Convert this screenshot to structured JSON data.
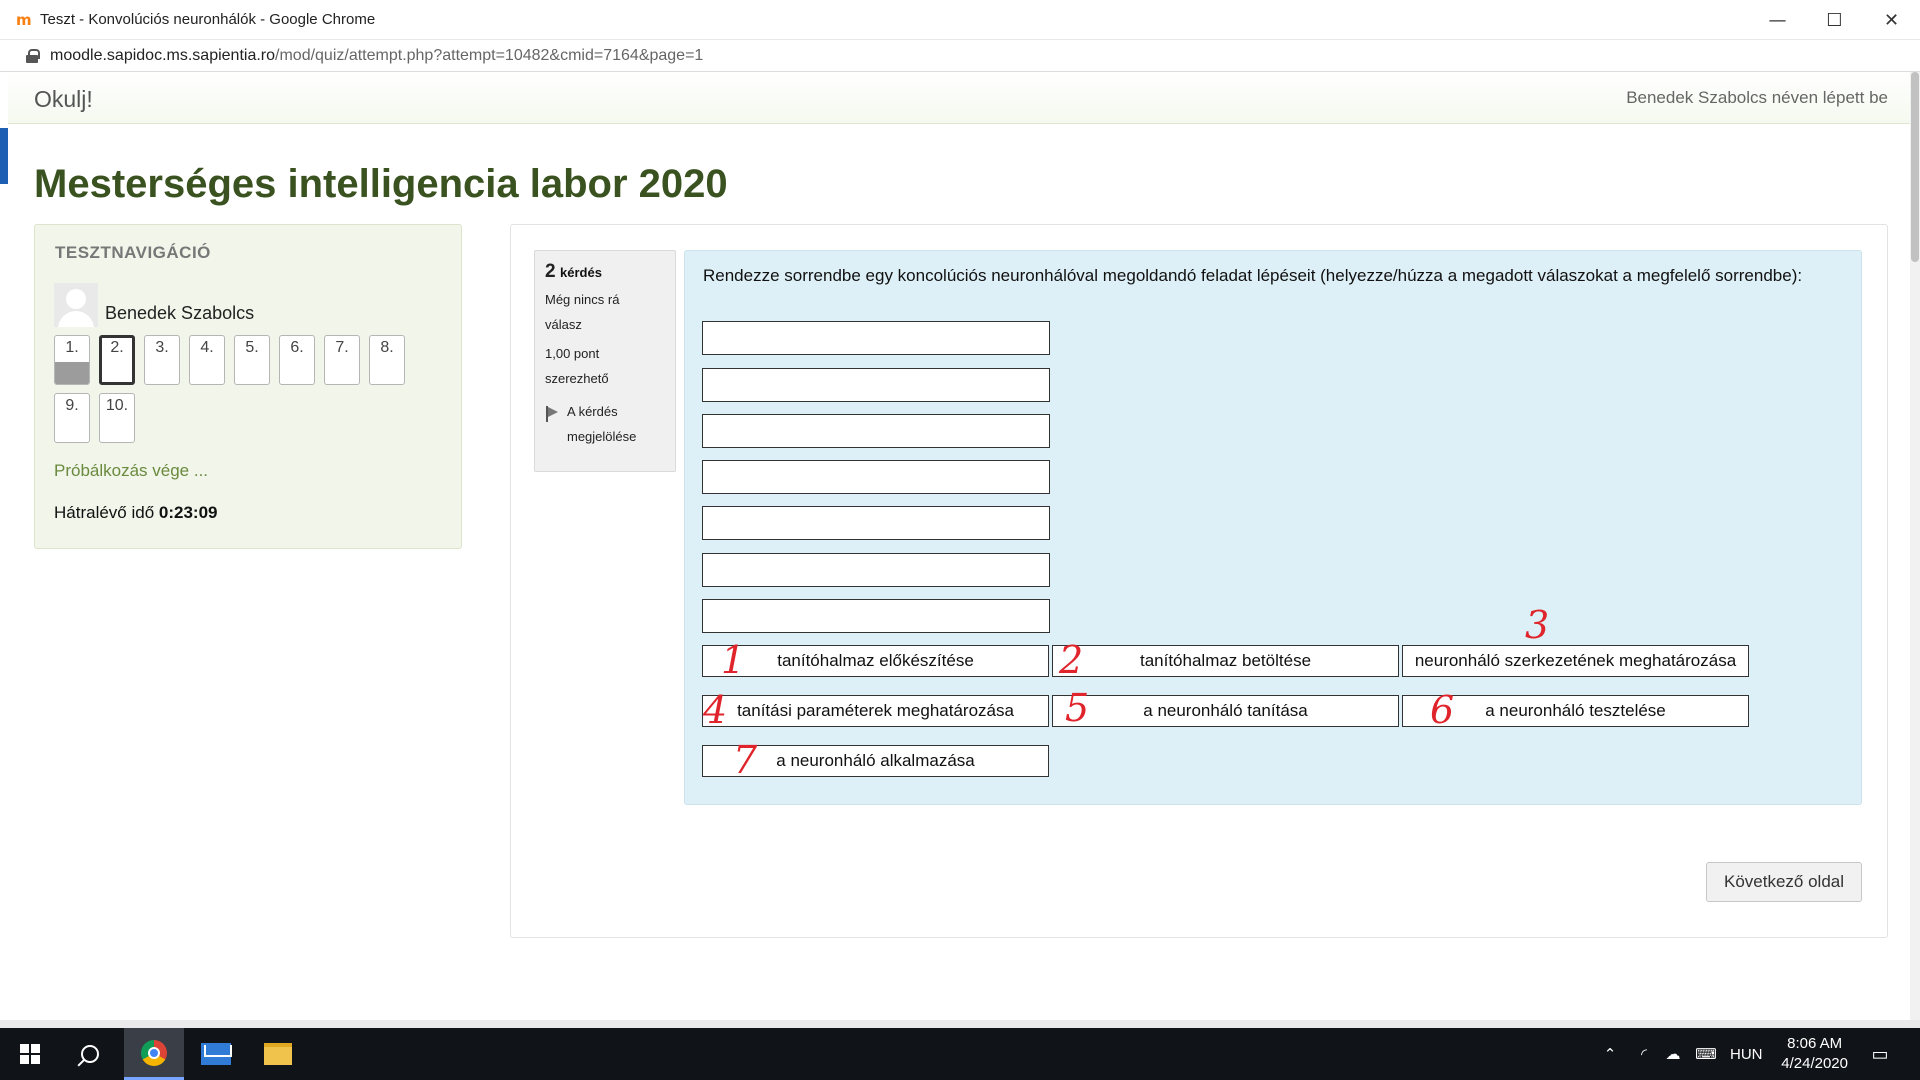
{
  "window": {
    "title": "Teszt - Konvolúciós neuronhálók - Google Chrome",
    "favicon": "m",
    "controls": [
      "—",
      "☐",
      "✕"
    ]
  },
  "address": {
    "domain": "moodle.sapidoc.ms.sapientia.ro",
    "path": "/mod/quiz/attempt.php?attempt=10482&cmid=7164&page=1"
  },
  "header": {
    "brand": "Okulj!",
    "login_info": "Benedek Szabolcs néven lépett be"
  },
  "page_title": "Mesterséges intelligencia labor 2020",
  "nav": {
    "heading": "TESZTNAVIGÁCIÓ",
    "user": "Benedek Szabolcs",
    "questions": [
      "1.",
      "2.",
      "3.",
      "4.",
      "5.",
      "6.",
      "7.",
      "8.",
      "9.",
      "10."
    ],
    "finish": "Próbálkozás vége ...",
    "timer_label": "Hátralévő idő",
    "timer_value": "0:23:09"
  },
  "question": {
    "number": "2",
    "label": "kérdés",
    "status_line1": "Még nincs rá",
    "status_line2": "válasz",
    "points_line1": "1,00 pont",
    "points_line2": "szerezhető",
    "flag_line1": "A kérdés",
    "flag_line2": "megjelölése",
    "text": "Rendezze sorrendbe egy koncolúciós neuronhálóval megoldandó feladat lépéseit (helyezze/húzza a megadott válaszokat a megfelelő sorrendbe):",
    "items": [
      "tanítóhalmaz előkészítése",
      "tanítóhalmaz betöltése",
      "neuronháló szerkezetének meghatározása",
      "tanítási paraméterek meghatározása",
      "a neuronháló tanítása",
      "a neuronháló tesztelése",
      "a neuronháló alkalmazása"
    ],
    "handwritten": [
      "1",
      "2",
      "3",
      "4",
      "5",
      "6",
      "7"
    ]
  },
  "next_button": "Következő oldal",
  "taskbar": {
    "language": "HUN",
    "time": "8:06 AM",
    "date": "4/24/2020"
  }
}
